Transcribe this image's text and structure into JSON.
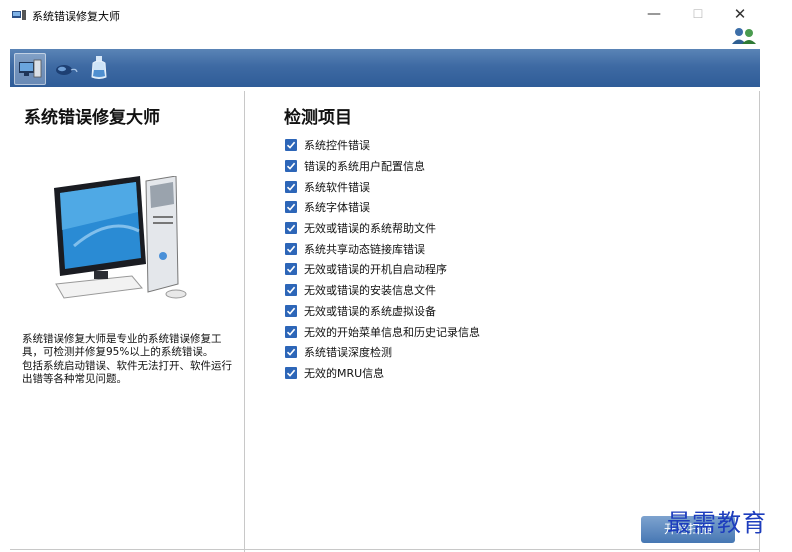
{
  "window": {
    "title": "系统错误修复大师",
    "minimize": "—",
    "maximize": "☐",
    "close": "✕"
  },
  "toolbar": {
    "tools": [
      {
        "icon": "computer-icon",
        "active": true
      },
      {
        "icon": "mouse-icon",
        "active": false
      },
      {
        "icon": "bottle-icon",
        "active": false
      }
    ]
  },
  "left_panel": {
    "title": "系统错误修复大师",
    "description": [
      "系统错误修复大师是专业的系统错误修复工具，可检测并修复95%以上的系统错误。",
      "包括系统启动错误、软件无法打开、软件运行出错等各种常见问题。"
    ]
  },
  "detection": {
    "title": "检测项目",
    "items": [
      {
        "label": "系统控件错误",
        "checked": true
      },
      {
        "label": "错误的系统用户配置信息",
        "checked": true
      },
      {
        "label": "系统软件错误",
        "checked": true
      },
      {
        "label": "系统字体错误",
        "checked": true
      },
      {
        "label": "无效或错误的系统帮助文件",
        "checked": true
      },
      {
        "label": "系统共享动态链接库错误",
        "checked": true
      },
      {
        "label": "无效或错误的开机自启动程序",
        "checked": true
      },
      {
        "label": "无效或错误的安装信息文件",
        "checked": true
      },
      {
        "label": "无效或错误的系统虚拟设备",
        "checked": true
      },
      {
        "label": "无效的开始菜单信息和历史记录信息",
        "checked": true
      },
      {
        "label": "系统错误深度检测",
        "checked": true
      },
      {
        "label": "无效的MRU信息",
        "checked": true
      }
    ]
  },
  "actions": {
    "start_label": "开始扫描"
  },
  "watermark": "最需教育",
  "colors": {
    "toolbar": "#3e6aa3",
    "checkbox": "#2d66b8",
    "watermark": "#1d3dbd"
  }
}
